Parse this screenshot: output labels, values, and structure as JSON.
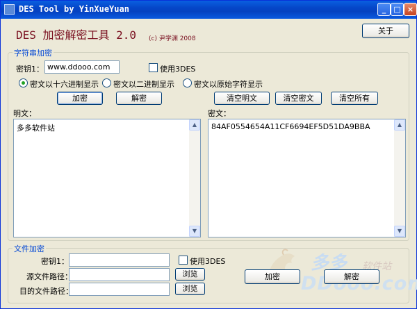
{
  "window": {
    "title": "DES Tool by YinXueYuan",
    "min_glyph": "_",
    "max_glyph": "□",
    "close_glyph": "×"
  },
  "header": {
    "app_title": "DES 加密解密工具 2.0",
    "copyright": "(c) 尹学渊 2008",
    "about_label": "关于"
  },
  "string_group": {
    "title": "字符串加密",
    "key_label": "密钥1：",
    "key_value": "www.ddooo.com",
    "use3des_label": "使用3DES",
    "radio_hex": "密文以十六进制显示",
    "radio_bin": "密文以二进制显示",
    "radio_raw": "密文以原始字符显示",
    "encrypt_label": "加密",
    "decrypt_label": "解密",
    "clear_plain_label": "清空明文",
    "clear_cipher_label": "清空密文",
    "clear_all_label": "清空所有",
    "plain_label": "明文：",
    "plain_text": "多多软件站",
    "cipher_label": "密文：",
    "cipher_text": "84AF0554654A11CF6694EF5D51DA9BBA"
  },
  "file_group": {
    "title": "文件加密",
    "key_label": "密钥1：",
    "key_value": "",
    "use3des_label": "使用3DES",
    "source_label": "源文件路径：",
    "source_value": "",
    "dest_label": "目的文件路径：",
    "dest_value": "",
    "browse_label": "浏览",
    "encrypt_label": "加密",
    "decrypt_label": "解密"
  },
  "watermark": {
    "line1": "多多",
    "line2": "软件站",
    "line3": "DDooo.com"
  },
  "colors": {
    "titlebar": "#0546c8",
    "app_title": "#7a1020",
    "group_title": "#0046d5",
    "window_bg": "#ece9d8"
  },
  "icons": [
    "app-icon",
    "minimize-icon",
    "maximize-icon",
    "close-icon",
    "scroll-up-icon",
    "scroll-down-icon",
    "horse-logo-icon"
  ]
}
